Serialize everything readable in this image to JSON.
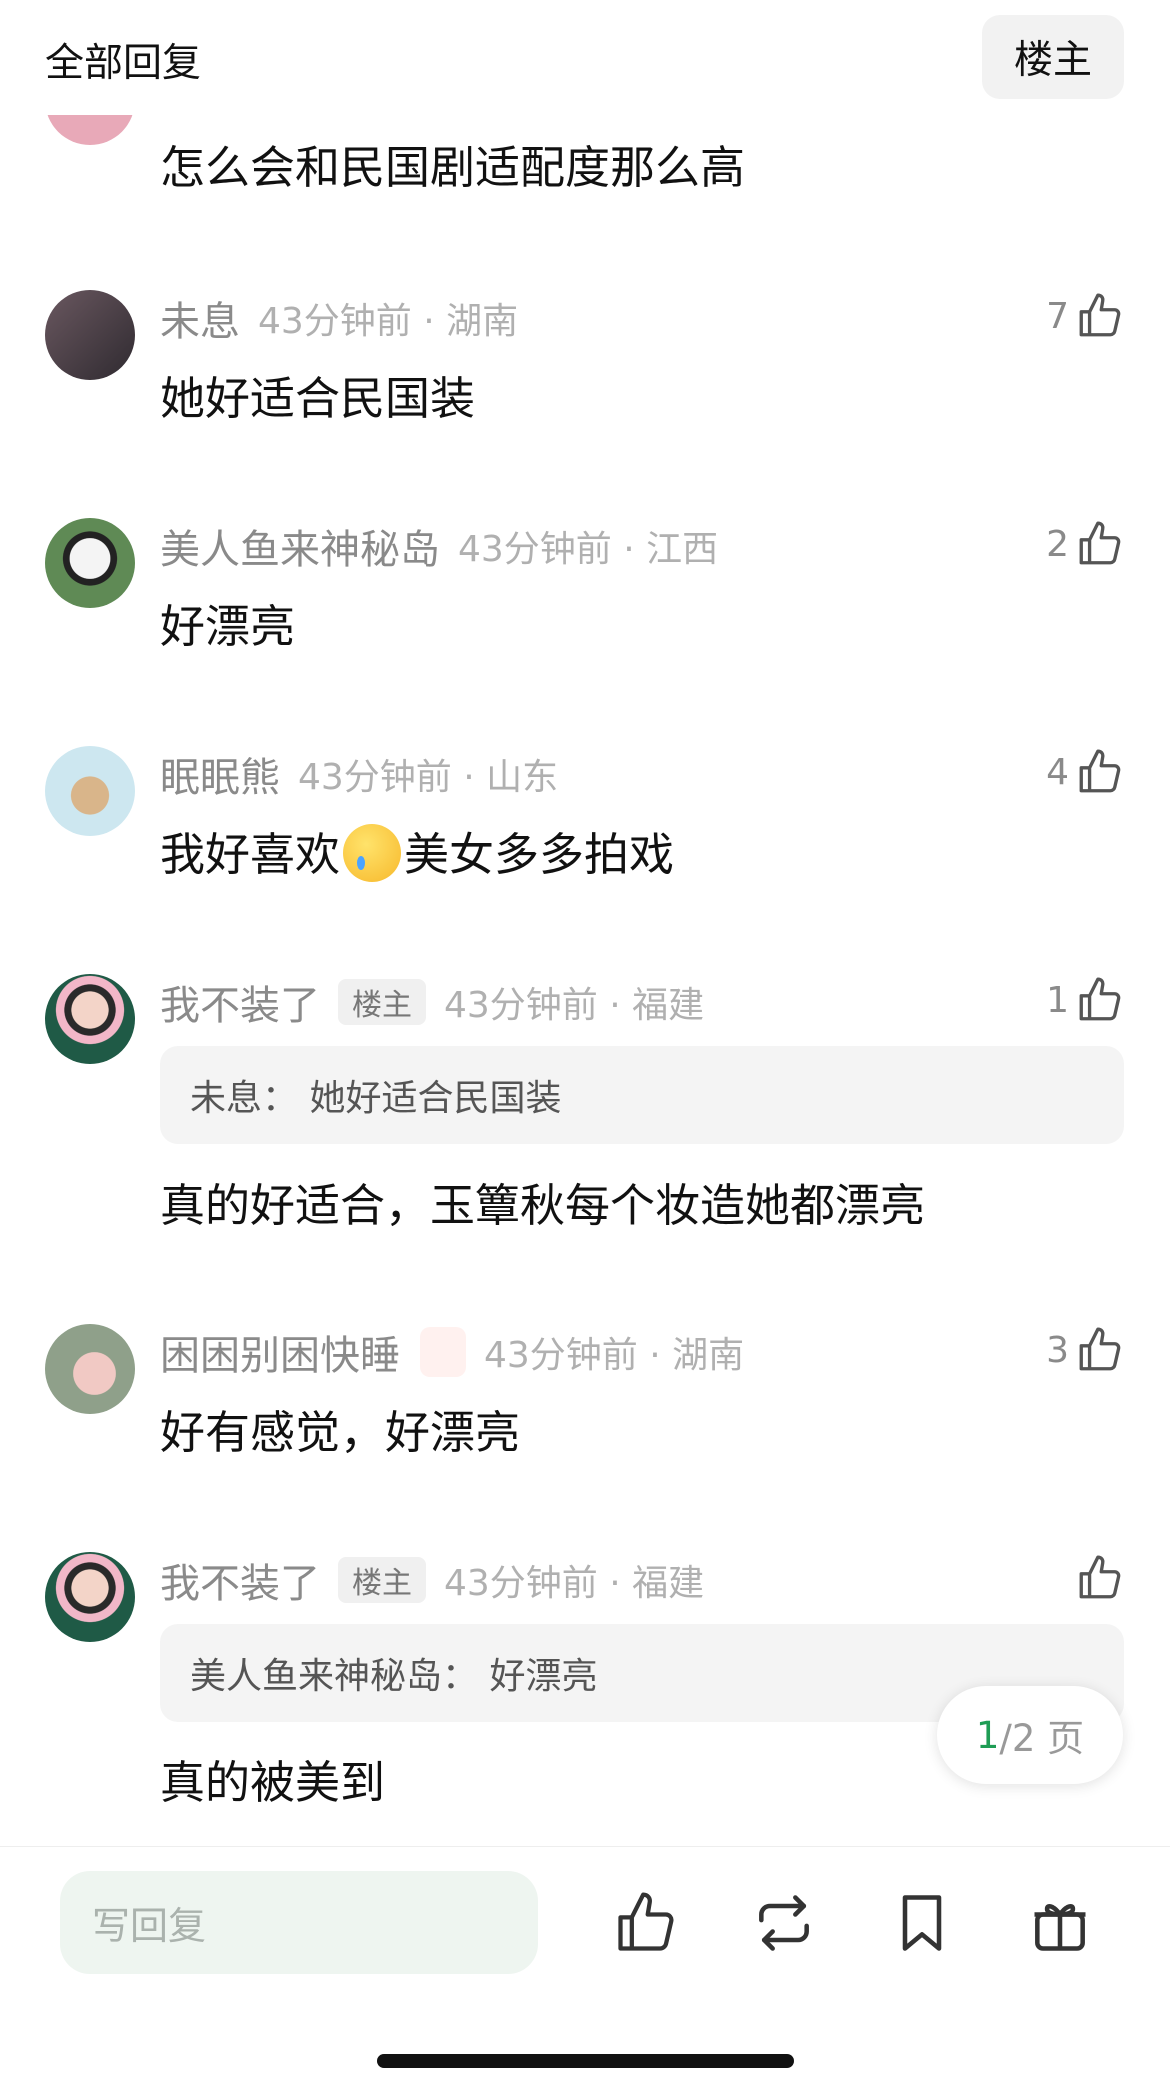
{
  "header": {
    "title": "全部回复",
    "owner_button": "楼主"
  },
  "partial_comment": {
    "text": "怎么会和民国剧适配度那么高"
  },
  "comments": [
    {
      "username": "未息",
      "time": "43分钟前 · 湖南",
      "likes": "7",
      "text": "她好适合民国装",
      "avatar_color": "#5b4a52"
    },
    {
      "username": "美人鱼来神秘岛",
      "time": "43分钟前 · 江西",
      "likes": "2",
      "text": "好漂亮",
      "avatar_color": "#3a5a3a"
    },
    {
      "username": "眠眠熊",
      "time": "43分钟前 · 山东",
      "likes": "4",
      "text_before": "我好喜欢",
      "emoji": "crying-face",
      "text_after": "美女多多拍戏",
      "avatar_color": "#cfe6ef"
    },
    {
      "username": "我不装了",
      "tag": "楼主",
      "time": "43分钟前 · 福建",
      "likes": "1",
      "quote": "未息：  她好适合民国装",
      "text": "真的好适合，玉簟秋每个妆造她都漂亮",
      "avatar_color": "#1f5a46"
    },
    {
      "username": "困困别困快睡",
      "badge": "cake-emoji",
      "time": "43分钟前 · 湖南",
      "likes": "3",
      "text": "好有感觉，好漂亮",
      "avatar_color": "#7c8f7a"
    },
    {
      "username": "我不装了",
      "tag": "楼主",
      "time": "43分钟前 · 福建",
      "likes": "",
      "quote": "美人鱼来神秘岛：  好漂亮",
      "text": "真的被美到",
      "avatar_color": "#1f5a46"
    }
  ],
  "pager": {
    "current": "1",
    "rest": "/2 页"
  },
  "bottom_bar": {
    "reply_placeholder": "写回复",
    "icons": [
      "thumbs-up-icon",
      "repost-icon",
      "bookmark-icon",
      "gift-icon"
    ]
  },
  "colors": {
    "accent": "#1f9d55",
    "input_bg": "#eef5f0",
    "muted_text": "#8a8a8a"
  }
}
